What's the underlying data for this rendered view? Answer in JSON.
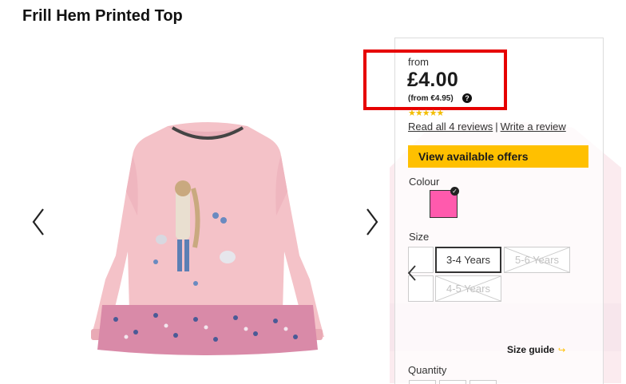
{
  "product": {
    "title": "Frill Hem Printed Top"
  },
  "pricing": {
    "from_label": "from",
    "price": "£4.00",
    "alt_price": "(from €4.95)",
    "help_icon": "question-circle-icon"
  },
  "reviews": {
    "rating_stars": 5,
    "stars_text": "★★★★★",
    "read_link": "Read all 4 reviews",
    "separator": "|",
    "write_link": "Write a review"
  },
  "offers": {
    "button_label": "View available offers"
  },
  "colour": {
    "label": "Colour",
    "selected_hex": "#ff5aad",
    "check_icon": "check-circle-icon"
  },
  "size": {
    "label": "Size",
    "options": [
      {
        "label": "3-4 Years",
        "state": "selected"
      },
      {
        "label": "5-6 Years",
        "state": "unavailable"
      },
      {
        "label": "4-5 Years",
        "state": "unavailable"
      }
    ],
    "guide_label": "Size guide",
    "guide_icon": "arrow-right-icon"
  },
  "quantity": {
    "label": "Quantity"
  },
  "gallery": {
    "prev_icon": "chevron-left-icon",
    "next_icon": "chevron-right-icon"
  },
  "colors": {
    "price_highlight": "#e60000",
    "offer_button": "#ffc000",
    "garment_pink": "#f4c2c8"
  }
}
